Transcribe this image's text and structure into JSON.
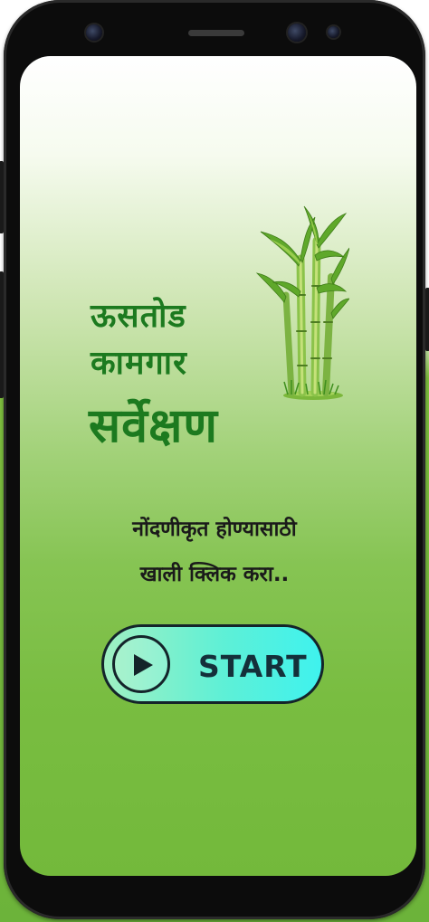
{
  "title": {
    "line1": "ऊसतोड",
    "line2": "कामगार",
    "line3": "सर्वेक्षण"
  },
  "instruction": {
    "line1": "नोंदणीकृत होण्यासाठी",
    "line2": "खाली क्लिक करा.."
  },
  "start_button": {
    "label": "START",
    "icon": "play-icon"
  },
  "illustration": {
    "icon": "sugarcane-illustration"
  },
  "colors": {
    "title_green": "#1c7a1f",
    "screen_green": "#73b93b",
    "button_gradient_start": "#9ff0c2",
    "button_gradient_end": "#3ff2ee",
    "button_outline": "#14242a"
  }
}
